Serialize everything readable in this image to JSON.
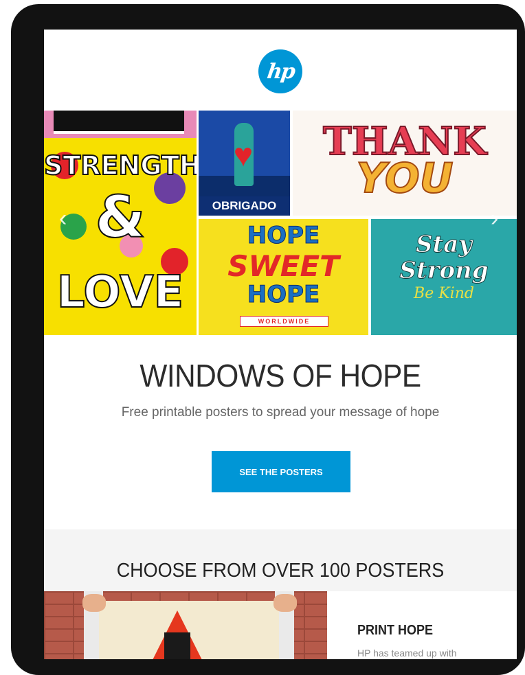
{
  "header": {
    "logo_text": "hp",
    "logo_icon": "hp-logo-icon"
  },
  "posters": {
    "p1_word_top": "STRENGTH",
    "p1_word_mid": "&",
    "p1_word_bottom": "LOVE",
    "p2_caption": "OBRIGADO",
    "p3_line1": "THANK",
    "p3_line2": "YOU",
    "p4_line1": "HOPE",
    "p4_line2": "SWEET",
    "p4_line3": "HOPE",
    "p4_strip": "WORLDWIDE",
    "p5_line1": "Stay",
    "p5_line2": "Strong",
    "p5_line3": "Be Kind"
  },
  "carousel": {
    "prev_icon": "chevron-left-icon",
    "next_icon": "chevron-right-icon"
  },
  "hero": {
    "title": "WINDOWS OF HOPE",
    "subtitle": "Free printable posters to spread your message of hope",
    "cta_label": "SEE THE POSTERS"
  },
  "section": {
    "title": "CHOOSE FROM OVER 100 POSTERS",
    "aside_title": "PRINT HOPE",
    "aside_body": "HP has teamed up with"
  },
  "colors": {
    "brand": "#0096d6",
    "frame": "#121212",
    "section_bg": "#f4f4f4"
  }
}
